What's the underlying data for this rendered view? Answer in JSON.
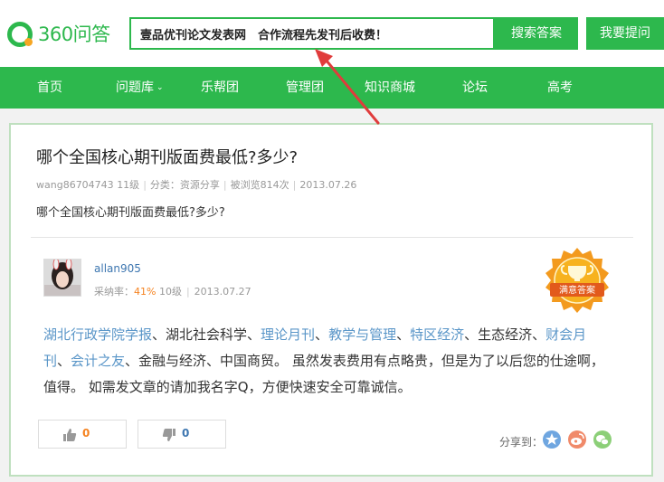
{
  "header": {
    "logo_text": "360问答",
    "search": {
      "value": "壹品优刊论文发表网　合作流程先发刊后收费！",
      "button": "搜索答案"
    },
    "ask_button": "我要提问"
  },
  "nav": {
    "items": [
      {
        "label": "首页"
      },
      {
        "label": "问题库",
        "dropdown": true
      },
      {
        "label": "乐帮团"
      },
      {
        "label": "管理团"
      },
      {
        "label": "知识商城"
      },
      {
        "label": "论坛"
      },
      {
        "label": "高考"
      }
    ]
  },
  "question": {
    "title": "哪个全国核心期刊版面费最低?多少?",
    "meta": {
      "user": "wang86704743",
      "level": "11级",
      "category": "分类：资源分享",
      "views": "被浏览814次",
      "date": "2013.07.26"
    },
    "body": "哪个全国核心期刊版面费最低?多少?"
  },
  "answer": {
    "user": "allan905",
    "adopt_label": "采纳率：",
    "adopt_rate": "41%",
    "level": "10级",
    "date": "2013.07.27",
    "badge": "满意答案",
    "segments": [
      {
        "text": "湖北行政学院学报",
        "link": true
      },
      {
        "text": "、湖北社会科学、",
        "link": false
      },
      {
        "text": "理论月刊",
        "link": true
      },
      {
        "text": "、",
        "link": false
      },
      {
        "text": "教学与管理",
        "link": true
      },
      {
        "text": "、",
        "link": false
      },
      {
        "text": "特区经济",
        "link": true
      },
      {
        "text": "、生态经济、",
        "link": false
      },
      {
        "text": "财会月刊",
        "link": true
      },
      {
        "text": "、",
        "link": false
      },
      {
        "text": "会计之友",
        "link": true
      },
      {
        "text": "、金融与经济、中国商贸。 虽然发表费用有点略贵，但是为了以后您的仕途啊，值得。 如需发文章的请加我名字Q，方便快速安全可靠诚信。",
        "link": false
      }
    ],
    "upvotes": "0",
    "downvotes": "0",
    "share_label": "分享到："
  },
  "colors": {
    "brand": "#2db84d",
    "link": "#5a96c8",
    "accent": "#f5821f",
    "arrow": "#e03c3c"
  }
}
